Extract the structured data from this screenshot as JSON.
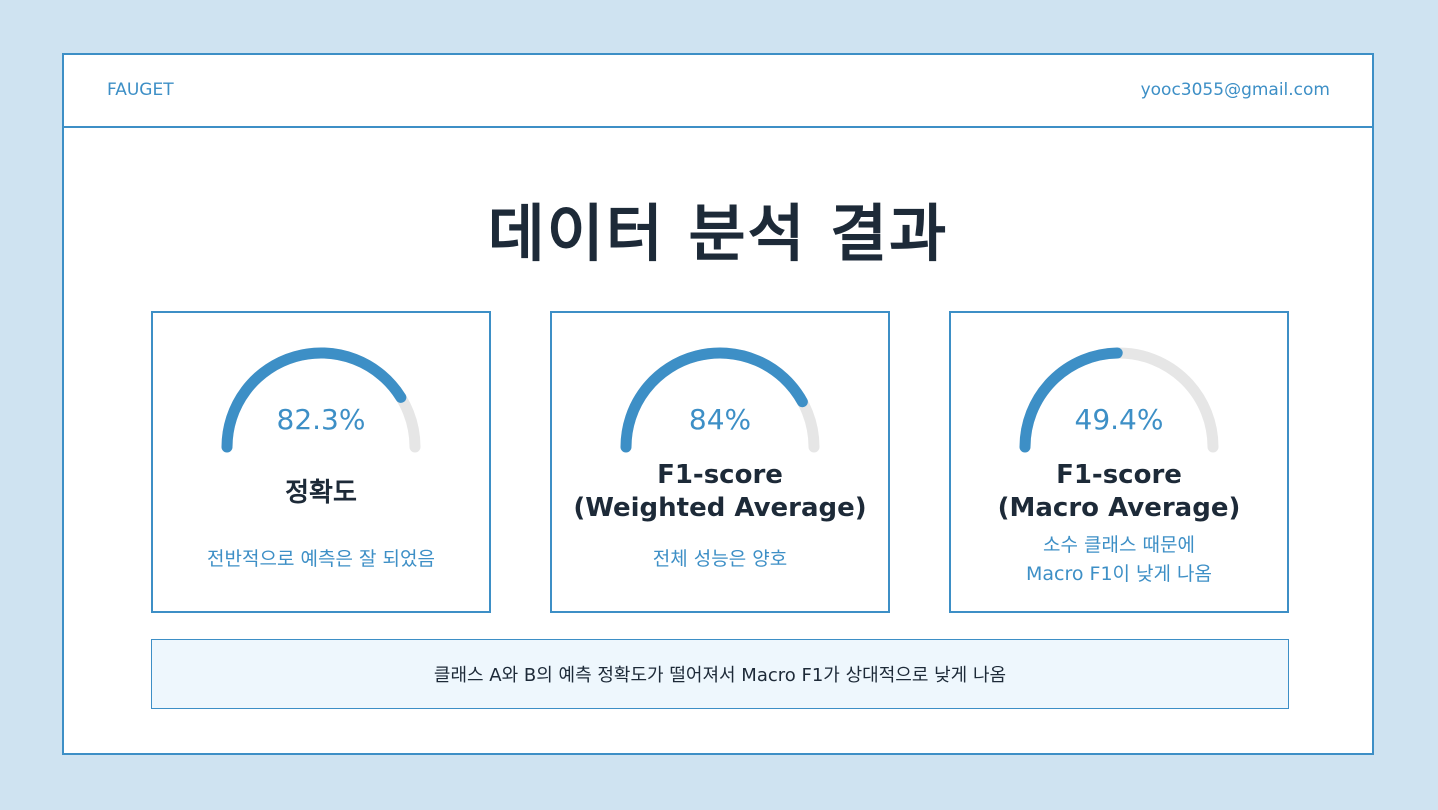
{
  "header": {
    "brand": "FAUGET",
    "email": "yooc3055@gmail.com"
  },
  "title": "데이터 분석 결과",
  "metrics": [
    {
      "value_text": "82.3%",
      "fraction": 0.823,
      "label_lines": [
        "정확도"
      ],
      "description_lines": [
        "전반적으로 예측은 잘 되었음"
      ]
    },
    {
      "value_text": "84%",
      "fraction": 0.84,
      "label_lines": [
        "F1-score",
        "(Weighted Average)"
      ],
      "description_lines": [
        "전체 성능은 양호"
      ]
    },
    {
      "value_text": "49.4%",
      "fraction": 0.494,
      "label_lines": [
        "F1-score",
        "(Macro Average)"
      ],
      "description_lines": [
        "소수 클래스 때문에",
        "Macro F1이 낮게 나옴"
      ]
    }
  ],
  "summary": "클래스 A와 B의 예측 정확도가 떨어져서 Macro F1가 상대적으로 낮게 나옴",
  "colors": {
    "background": "#cfe3f1",
    "accent": "#3d8fc6",
    "gauge_track": "#e6e6e6",
    "title_text": "#1d2a38"
  }
}
